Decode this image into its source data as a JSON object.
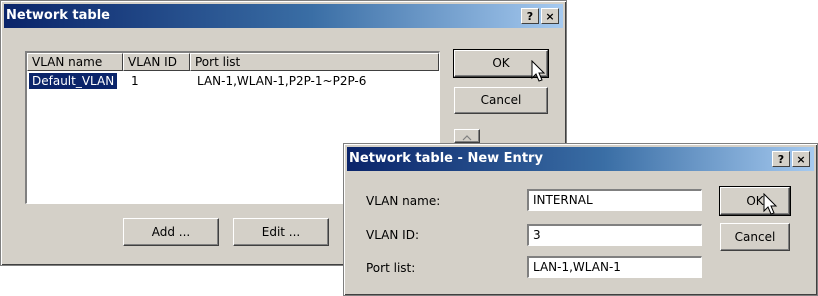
{
  "network_table": {
    "title": "Network table",
    "help_button": "?",
    "close_button": "×",
    "columns": [
      "VLAN name",
      "VLAN ID",
      "Port list"
    ],
    "rows": [
      {
        "name": "Default_VLAN",
        "id": "1",
        "ports": "LAN-1,WLAN-1,P2P-1~P2P-6"
      }
    ],
    "ok_label": "OK",
    "cancel_label": "Cancel",
    "add_label": "Add ...",
    "edit_label": "Edit ..."
  },
  "new_entry": {
    "title": "Network table - New Entry",
    "help_button": "?",
    "close_button": "×",
    "fields": [
      {
        "label": "VLAN name:",
        "value": "INTERNAL"
      },
      {
        "label": "VLAN ID:",
        "value": "3"
      },
      {
        "label": "Port list:",
        "value": "LAN-1,WLAN-1"
      }
    ],
    "ok_label": "OK",
    "cancel_label": "Cancel"
  },
  "colors": {
    "title_start": "#0a246a",
    "title_end": "#a6caf0",
    "selection": "#0a246a",
    "face": "#d4d0c8"
  }
}
